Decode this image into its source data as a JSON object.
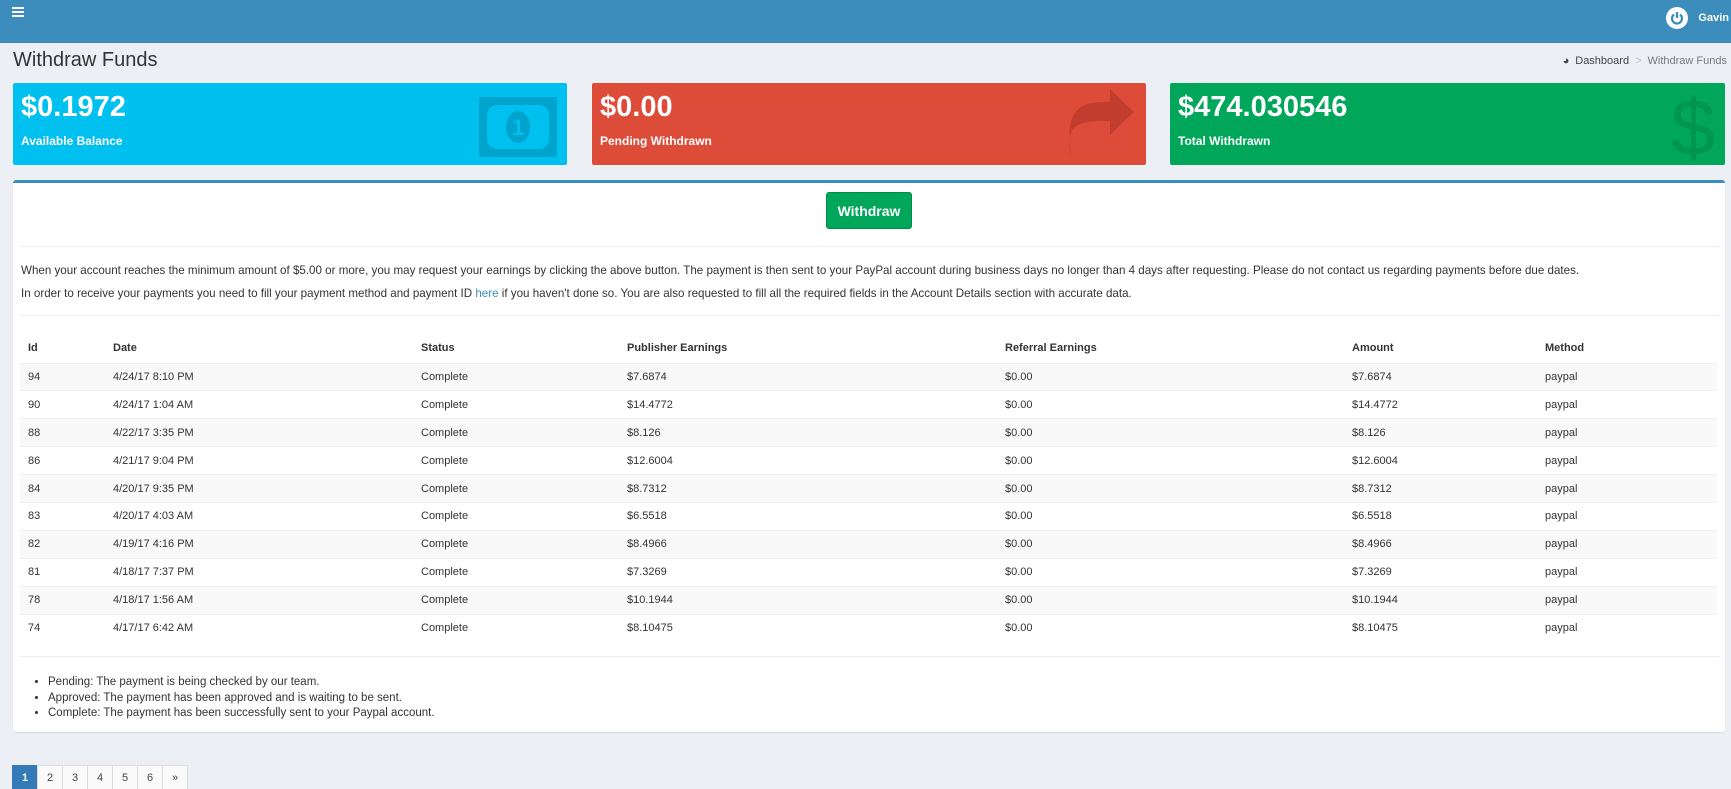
{
  "header": {
    "user_name": "Gavin"
  },
  "page": {
    "title": "Withdraw Funds"
  },
  "breadcrumb": {
    "home": "Dashboard",
    "current": "Withdraw Funds"
  },
  "cards": [
    {
      "value": "$0.1972",
      "label": "Available Balance",
      "color": "#00c0ef"
    },
    {
      "value": "$0.00",
      "label": "Pending Withdrawn",
      "color": "#dd4b39"
    },
    {
      "value": "$474.030546",
      "label": "Total Withdrawn",
      "color": "#00a65a"
    }
  ],
  "withdraw_label": "Withdraw",
  "info": {
    "p1": "When your account reaches the minimum amount of $5.00 or more, you may request your earnings by clicking the above button. The payment is then sent to your PayPal account during business days no longer than 4 days after requesting. Please do not contact us regarding payments before due dates.",
    "p2_before": "In order to receive your payments you need to fill your payment method and payment ID ",
    "p2_link": "here",
    "p2_after": " if you haven't done so. You are also requested to fill all the required fields in the Account Details section with accurate data."
  },
  "table": {
    "headers": [
      "Id",
      "Date",
      "Status",
      "Publisher Earnings",
      "Referral Earnings",
      "Amount",
      "Method"
    ],
    "rows": [
      [
        "94",
        "4/24/17 8:10 PM",
        "Complete",
        "$7.6874",
        "$0.00",
        "$7.6874",
        "paypal"
      ],
      [
        "90",
        "4/24/17 1:04 AM",
        "Complete",
        "$14.4772",
        "$0.00",
        "$14.4772",
        "paypal"
      ],
      [
        "88",
        "4/22/17 3:35 PM",
        "Complete",
        "$8.126",
        "$0.00",
        "$8.126",
        "paypal"
      ],
      [
        "86",
        "4/21/17 9:04 PM",
        "Complete",
        "$12.6004",
        "$0.00",
        "$12.6004",
        "paypal"
      ],
      [
        "84",
        "4/20/17 9:35 PM",
        "Complete",
        "$8.7312",
        "$0.00",
        "$8.7312",
        "paypal"
      ],
      [
        "83",
        "4/20/17 4:03 AM",
        "Complete",
        "$6.5518",
        "$0.00",
        "$6.5518",
        "paypal"
      ],
      [
        "82",
        "4/19/17 4:16 PM",
        "Complete",
        "$8.4966",
        "$0.00",
        "$8.4966",
        "paypal"
      ],
      [
        "81",
        "4/18/17 7:37 PM",
        "Complete",
        "$7.3269",
        "$0.00",
        "$7.3269",
        "paypal"
      ],
      [
        "78",
        "4/18/17 1:56 AM",
        "Complete",
        "$10.1944",
        "$0.00",
        "$10.1944",
        "paypal"
      ],
      [
        "74",
        "4/17/17 6:42 AM",
        "Complete",
        "$8.10475",
        "$0.00",
        "$8.10475",
        "paypal"
      ]
    ]
  },
  "legend": [
    "Pending: The payment is being checked by our team.",
    "Approved: The payment has been approved and is waiting to be sent.",
    "Complete: The payment has been successfully sent to your Paypal account."
  ],
  "pagination": [
    "1",
    "2",
    "3",
    "4",
    "5",
    "6",
    "»"
  ]
}
